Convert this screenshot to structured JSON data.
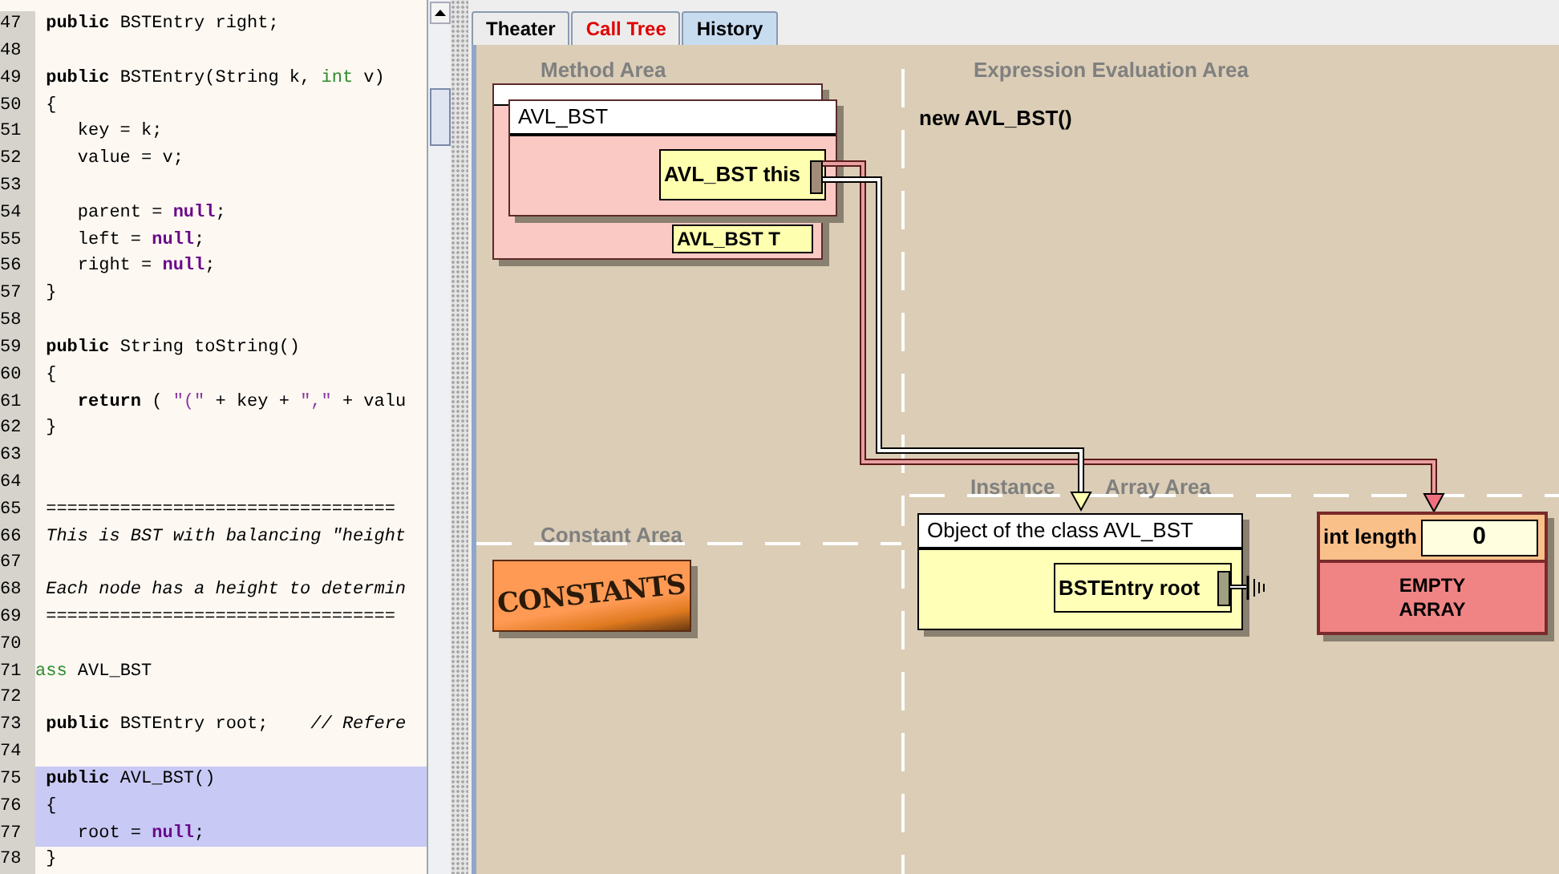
{
  "code_editor": {
    "lines": [
      {
        "number": "47",
        "selected": false,
        "tokens": [
          {
            "kind": "kw",
            "text": " public"
          },
          {
            "kind": "plain",
            "text": " BSTEntry right;"
          }
        ]
      },
      {
        "number": "48",
        "selected": false
      },
      {
        "number": "49",
        "selected": false,
        "tokens": [
          {
            "kind": "kw",
            "text": " public"
          },
          {
            "kind": "plain",
            "text": " BSTEntry(String k, "
          },
          {
            "kind": "type",
            "text": "int"
          },
          {
            "kind": "plain",
            "text": " v)"
          }
        ]
      },
      {
        "number": "50",
        "selected": false,
        "tokens": [
          {
            "kind": "plain",
            "text": " {"
          }
        ]
      },
      {
        "number": "51",
        "selected": false,
        "tokens": [
          {
            "kind": "plain",
            "text": "    key = k;"
          }
        ]
      },
      {
        "number": "52",
        "selected": false,
        "tokens": [
          {
            "kind": "plain",
            "text": "    value = v;"
          }
        ]
      },
      {
        "number": "53",
        "selected": false
      },
      {
        "number": "54",
        "selected": false,
        "tokens": [
          {
            "kind": "plain",
            "text": "    parent = "
          },
          {
            "kind": "null",
            "text": "null"
          },
          {
            "kind": "plain",
            "text": ";"
          }
        ]
      },
      {
        "number": "55",
        "selected": false,
        "tokens": [
          {
            "kind": "plain",
            "text": "    left = "
          },
          {
            "kind": "null",
            "text": "null"
          },
          {
            "kind": "plain",
            "text": ";"
          }
        ]
      },
      {
        "number": "56",
        "selected": false,
        "tokens": [
          {
            "kind": "plain",
            "text": "    right = "
          },
          {
            "kind": "null",
            "text": "null"
          },
          {
            "kind": "plain",
            "text": ";"
          }
        ]
      },
      {
        "number": "57",
        "selected": false,
        "tokens": [
          {
            "kind": "plain",
            "text": " }"
          }
        ]
      },
      {
        "number": "58",
        "selected": false
      },
      {
        "number": "59",
        "selected": false,
        "tokens": [
          {
            "kind": "kw",
            "text": " public"
          },
          {
            "kind": "plain",
            "text": " String toString()"
          }
        ]
      },
      {
        "number": "60",
        "selected": false,
        "tokens": [
          {
            "kind": "plain",
            "text": " {"
          }
        ]
      },
      {
        "number": "61",
        "selected": false,
        "tokens": [
          {
            "kind": "kw",
            "text": "    return"
          },
          {
            "kind": "plain",
            "text": " ( "
          },
          {
            "kind": "str",
            "text": "\"(\""
          },
          {
            "kind": "plain",
            "text": " + key + "
          },
          {
            "kind": "str",
            "text": "\",\""
          },
          {
            "kind": "plain",
            "text": " + valu"
          }
        ]
      },
      {
        "number": "62",
        "selected": false,
        "tokens": [
          {
            "kind": "plain",
            "text": " }"
          }
        ]
      },
      {
        "number": "63",
        "selected": false
      },
      {
        "number": "64",
        "selected": false
      },
      {
        "number": "65",
        "selected": false,
        "tokens": [
          {
            "kind": "comment",
            "text": " ================================="
          }
        ]
      },
      {
        "number": "66",
        "selected": false,
        "tokens": [
          {
            "kind": "comment",
            "text": " This is BST with balancing \"height"
          }
        ]
      },
      {
        "number": "67",
        "selected": false
      },
      {
        "number": "68",
        "selected": false,
        "tokens": [
          {
            "kind": "comment",
            "text": " Each node has a height to determin"
          }
        ]
      },
      {
        "number": "69",
        "selected": false,
        "tokens": [
          {
            "kind": "comment",
            "text": " ================================="
          }
        ]
      },
      {
        "number": "70",
        "selected": false
      },
      {
        "number": "71",
        "selected": false,
        "tokens": [
          {
            "kind": "type",
            "text": "ass"
          },
          {
            "kind": "plain",
            "text": " AVL_BST"
          }
        ]
      },
      {
        "number": "72",
        "selected": false
      },
      {
        "number": "73",
        "selected": false,
        "tokens": [
          {
            "kind": "kw",
            "text": " public"
          },
          {
            "kind": "plain",
            "text": " BSTEntry root;    "
          },
          {
            "kind": "comment",
            "text": "// Refere"
          }
        ]
      },
      {
        "number": "74",
        "selected": false
      },
      {
        "number": "75",
        "selected": true,
        "tokens": [
          {
            "kind": "kw",
            "text": " public"
          },
          {
            "kind": "plain",
            "text": " AVL_BST()"
          }
        ]
      },
      {
        "number": "76",
        "selected": true,
        "tokens": [
          {
            "kind": "plain",
            "text": " {"
          }
        ]
      },
      {
        "number": "77",
        "selected": true,
        "tokens": [
          {
            "kind": "plain",
            "text": "    root = "
          },
          {
            "kind": "null",
            "text": "null"
          },
          {
            "kind": "plain",
            "text": ";"
          }
        ]
      },
      {
        "number": "78",
        "selected": false,
        "tokens": [
          {
            "kind": "plain",
            "text": " }"
          }
        ]
      }
    ]
  },
  "tabs": [
    {
      "label": "Theater",
      "selected": false,
      "color": "#000000"
    },
    {
      "label": "Call Tree",
      "selected": false,
      "color": "#e00000"
    },
    {
      "label": "History",
      "selected": true,
      "color": "#000000"
    }
  ],
  "theater": {
    "method_area": {
      "title": "Method Area",
      "frames": [
        {
          "title": "AVL_BST",
          "variables": [
            {
              "label": "AVL_BST this"
            }
          ]
        }
      ],
      "hidden_variable": "AVL_BST T"
    },
    "expression_area": {
      "title": "Expression Evaluation Area",
      "expression": "new AVL_BST()"
    },
    "constant_area": {
      "title": "Constant Area",
      "badge": "CONSTANTS"
    },
    "instance_area": {
      "title": [
        "Instance",
        "Array Area"
      ],
      "object": {
        "title": "Object of the class AVL_BST",
        "field": "BSTEntry root"
      },
      "array": {
        "length_label": "int length",
        "length_value": "0",
        "note_lines": [
          "EMPTY",
          "ARRAY"
        ]
      }
    }
  }
}
